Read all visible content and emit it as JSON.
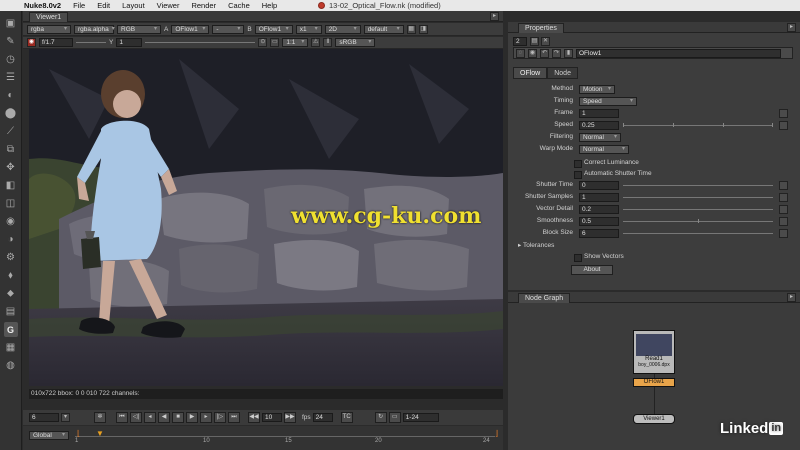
{
  "menubar": {
    "apple": "",
    "app_name": "Nuke8.0v2",
    "items": [
      "File",
      "Edit",
      "Layout",
      "Viewer",
      "Render",
      "Cache",
      "Help"
    ],
    "window_title": "13-02_Optical_Flow.nk (modified)"
  },
  "viewer": {
    "tab": "Viewer1",
    "row1": {
      "channels": "rgba",
      "alpha": "rgba.alpha",
      "display": "RGB",
      "a_label": "A",
      "input_a": "OFlow1",
      "dash": "-",
      "b_label": "B",
      "input_b": "OFlow1",
      "zoom": "x1",
      "view": "2D",
      "lut": "default"
    },
    "row2": {
      "fstop": "f/1.7",
      "gain": "1",
      "y_label": "Y",
      "gamma": "1",
      "proxy": "1:1",
      "colorspace": "sRGB"
    },
    "watermark": "www.cg-ku.com",
    "status": "010x722 bbox: 0 0 010 722 channels:",
    "playback": {
      "frame": "6",
      "fps_label": "fps",
      "fps": "24",
      "increment": "10",
      "end": "TC",
      "range": "1-24",
      "global": "Global"
    },
    "timeline_ticks": [
      "1",
      "10",
      "15",
      "20",
      "24"
    ]
  },
  "properties": {
    "title": "Properties",
    "count": "2",
    "node_name": "OFlow1",
    "tabs": [
      "OFlow",
      "Node"
    ],
    "knobs": {
      "method": {
        "label": "Method",
        "value": "Motion"
      },
      "timing": {
        "label": "Timing",
        "value": "Speed"
      },
      "frame": {
        "label": "Frame",
        "value": "1"
      },
      "speed": {
        "label": "Speed",
        "value": "0.25"
      },
      "filtering": {
        "label": "Filtering",
        "value": "Normal"
      },
      "warp_mode": {
        "label": "Warp Mode",
        "value": "Normal"
      },
      "correct_luminance": {
        "label": "Correct Luminance"
      },
      "auto_shutter": {
        "label": "Automatic Shutter Time"
      },
      "shutter_time": {
        "label": "Shutter Time",
        "value": "0"
      },
      "shutter_samples": {
        "label": "Shutter Samples",
        "value": "1"
      },
      "vector_detail": {
        "label": "Vector Detail",
        "value": "0.2"
      },
      "smoothness": {
        "label": "Smoothness",
        "value": "0.5"
      },
      "block_size": {
        "label": "Block Size",
        "value": "6"
      },
      "tolerances": {
        "label": "Tolerances"
      },
      "show_vectors": {
        "label": "Show Vectors"
      }
    },
    "about": "About"
  },
  "node_graph": {
    "title": "Node Graph",
    "read_node": "Read1",
    "read_sub": "boy_0006.dpx",
    "oflow_node": "OFlow1",
    "viewer_node": "Viewer1"
  },
  "brand": {
    "name": "Linked",
    "in": "in"
  }
}
